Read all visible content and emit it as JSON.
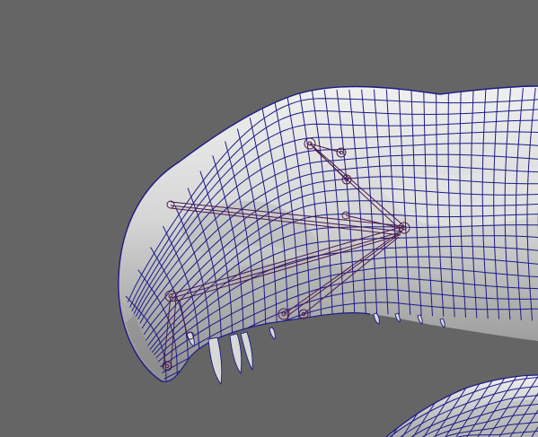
{
  "viewport": {
    "background": "#656565",
    "surface_color": "#d9d9d9",
    "surface_shade": "#9a9a9a",
    "wire_color": "#1d1b86",
    "rig_color": "#4a1a4a"
  },
  "scene": {
    "objects": [
      {
        "name": "creature-head-mesh",
        "icon": "wireframe-mesh-icon"
      },
      {
        "name": "lower-jaw-mesh",
        "icon": "wireframe-mesh-icon"
      },
      {
        "name": "jaw-rig-joints",
        "icon": "bone-joint-icon"
      }
    ]
  }
}
